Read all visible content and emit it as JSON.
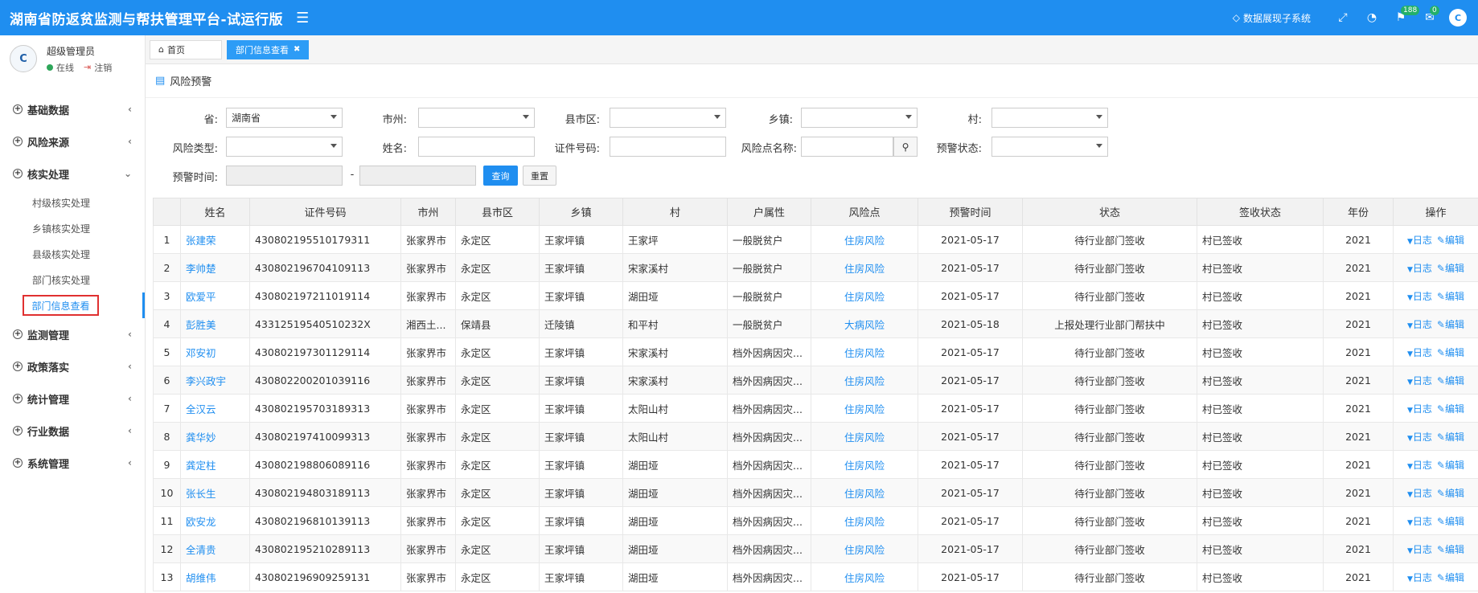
{
  "header": {
    "title": "湖南省防返贫监测与帮扶管理平台-试运行版",
    "screen_link": "数据展现子系统",
    "badge_notifications": "188",
    "badge_messages": "0"
  },
  "user": {
    "name": "超级管理员",
    "status": "在线",
    "logout": "注销"
  },
  "sidebar": {
    "items": [
      {
        "label": "基础数据"
      },
      {
        "label": "风险来源"
      },
      {
        "label": "核实处理"
      },
      {
        "label": "监测管理"
      },
      {
        "label": "政策落实"
      },
      {
        "label": "统计管理"
      },
      {
        "label": "行业数据"
      },
      {
        "label": "系统管理"
      }
    ],
    "sub_items": [
      {
        "label": "村级核实处理"
      },
      {
        "label": "乡镇核实处理"
      },
      {
        "label": "县级核实处理"
      },
      {
        "label": "部门核实处理"
      },
      {
        "label": "部门信息查看"
      }
    ]
  },
  "tabs": {
    "home": "首页",
    "active": "部门信息查看"
  },
  "panel": {
    "title": "风险预警"
  },
  "filters": {
    "province_label": "省:",
    "province_value": "湖南省",
    "city_label": "市州:",
    "county_label": "县市区:",
    "town_label": "乡镇:",
    "village_label": "村:",
    "risk_type_label": "风险类型:",
    "name_label": "姓名:",
    "id_label": "证件号码:",
    "risk_point_label": "风险点名称:",
    "warn_status_label": "预警状态:",
    "warn_time_label": "预警时间:",
    "dash": "-",
    "query": "查询",
    "reset": "重置"
  },
  "table": {
    "headers": [
      "",
      "姓名",
      "证件号码",
      "市州",
      "县市区",
      "乡镇",
      "村",
      "户属性",
      "风险点",
      "预警时间",
      "状态",
      "签收状态",
      "年份",
      "操作"
    ],
    "op_log": "日志",
    "op_edit": "编辑",
    "rows": [
      [
        "1",
        "张建荣",
        "430802195510179311",
        "张家界市",
        "永定区",
        "王家坪镇",
        "王家坪",
        "一般脱贫户",
        "住房风险",
        "2021-05-17",
        "待行业部门签收",
        "村已签收",
        "2021"
      ],
      [
        "2",
        "李帅楚",
        "430802196704109113",
        "张家界市",
        "永定区",
        "王家坪镇",
        "宋家溪村",
        "一般脱贫户",
        "住房风险",
        "2021-05-17",
        "待行业部门签收",
        "村已签收",
        "2021"
      ],
      [
        "3",
        "欧爱平",
        "430802197211019114",
        "张家界市",
        "永定区",
        "王家坪镇",
        "湖田垭",
        "一般脱贫户",
        "住房风险",
        "2021-05-17",
        "待行业部门签收",
        "村已签收",
        "2021"
      ],
      [
        "4",
        "彭胜美",
        "43312519540510232X",
        "湘西土...",
        "保靖县",
        "迁陵镇",
        "和平村",
        "一般脱贫户",
        "大病风险",
        "2021-05-18",
        "上报处理行业部门帮扶中",
        "村已签收",
        "2021"
      ],
      [
        "5",
        "邓安初",
        "430802197301129114",
        "张家界市",
        "永定区",
        "王家坪镇",
        "宋家溪村",
        "档外因病因灾...",
        "住房风险",
        "2021-05-17",
        "待行业部门签收",
        "村已签收",
        "2021"
      ],
      [
        "6",
        "李兴政宇",
        "430802200201039116",
        "张家界市",
        "永定区",
        "王家坪镇",
        "宋家溪村",
        "档外因病因灾...",
        "住房风险",
        "2021-05-17",
        "待行业部门签收",
        "村已签收",
        "2021"
      ],
      [
        "7",
        "全汉云",
        "430802195703189313",
        "张家界市",
        "永定区",
        "王家坪镇",
        "太阳山村",
        "档外因病因灾...",
        "住房风险",
        "2021-05-17",
        "待行业部门签收",
        "村已签收",
        "2021"
      ],
      [
        "8",
        "龚华妙",
        "430802197410099313",
        "张家界市",
        "永定区",
        "王家坪镇",
        "太阳山村",
        "档外因病因灾...",
        "住房风险",
        "2021-05-17",
        "待行业部门签收",
        "村已签收",
        "2021"
      ],
      [
        "9",
        "龚定柱",
        "430802198806089116",
        "张家界市",
        "永定区",
        "王家坪镇",
        "湖田垭",
        "档外因病因灾...",
        "住房风险",
        "2021-05-17",
        "待行业部门签收",
        "村已签收",
        "2021"
      ],
      [
        "10",
        "张长生",
        "430802194803189113",
        "张家界市",
        "永定区",
        "王家坪镇",
        "湖田垭",
        "档外因病因灾...",
        "住房风险",
        "2021-05-17",
        "待行业部门签收",
        "村已签收",
        "2021"
      ],
      [
        "11",
        "欧安龙",
        "430802196810139113",
        "张家界市",
        "永定区",
        "王家坪镇",
        "湖田垭",
        "档外因病因灾...",
        "住房风险",
        "2021-05-17",
        "待行业部门签收",
        "村已签收",
        "2021"
      ],
      [
        "12",
        "全清贵",
        "430802195210289113",
        "张家界市",
        "永定区",
        "王家坪镇",
        "湖田垭",
        "档外因病因灾...",
        "住房风险",
        "2021-05-17",
        "待行业部门签收",
        "村已签收",
        "2021"
      ],
      [
        "13",
        "胡维伟",
        "430802196909259131",
        "张家界市",
        "永定区",
        "王家坪镇",
        "湖田垭",
        "档外因病因灾...",
        "住房风险",
        "2021-05-17",
        "待行业部门签收",
        "村已签收",
        "2021"
      ]
    ]
  },
  "colors": {
    "primary": "#1f8ef0",
    "highlight_border": "#e03030",
    "online": "#2ea65a"
  }
}
